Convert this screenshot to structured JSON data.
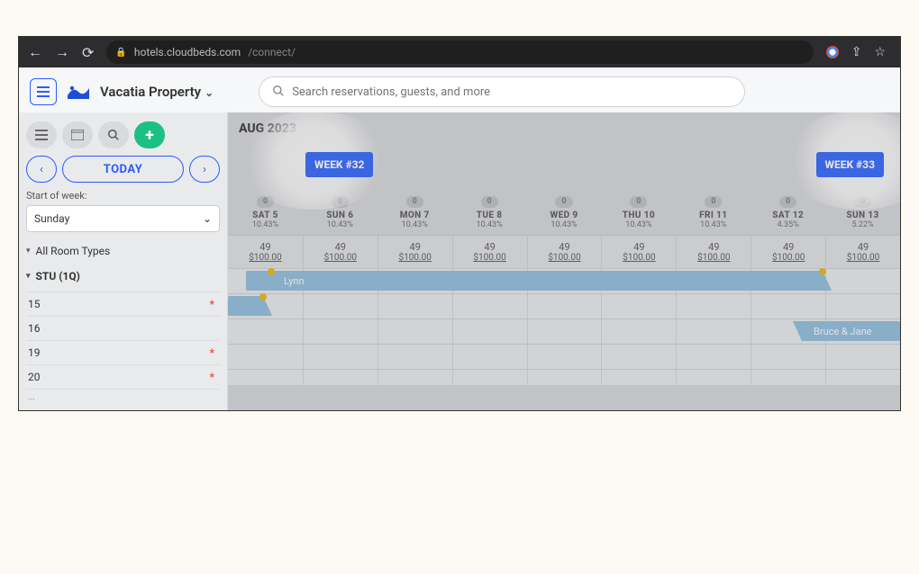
{
  "browser": {
    "url_host": "hotels.cloudbeds.com",
    "url_path": "/connect/"
  },
  "header": {
    "property_name": "Vacatia Property",
    "search_placeholder": "Search reservations, guests, and more"
  },
  "sidebar": {
    "today_label": "TODAY",
    "start_of_week_label": "Start of week:",
    "start_of_week_value": "Sunday",
    "all_room_types": "All Room Types",
    "group_label": "STU (1Q)",
    "rooms": [
      "15",
      "16",
      "19",
      "20"
    ]
  },
  "calendar": {
    "month_label": "AUG 2023",
    "week_chip_1": "WEEK #32",
    "week_chip_2": "WEEK #33",
    "days": [
      {
        "badge": "0",
        "name": "SAT 5",
        "pct": "10.43%",
        "avail": "49",
        "price": "$100.00"
      },
      {
        "badge": "0",
        "name": "SUN 6",
        "pct": "10.43%",
        "avail": "49",
        "price": "$100.00"
      },
      {
        "badge": "0",
        "name": "MON 7",
        "pct": "10.43%",
        "avail": "49",
        "price": "$100.00"
      },
      {
        "badge": "0",
        "name": "TUE 8",
        "pct": "10.43%",
        "avail": "49",
        "price": "$100.00"
      },
      {
        "badge": "0",
        "name": "WED 9",
        "pct": "10.43%",
        "avail": "49",
        "price": "$100.00"
      },
      {
        "badge": "0",
        "name": "THU 10",
        "pct": "10.43%",
        "avail": "49",
        "price": "$100.00"
      },
      {
        "badge": "0",
        "name": "FRI 11",
        "pct": "10.43%",
        "avail": "49",
        "price": "$100.00"
      },
      {
        "badge": "0",
        "name": "SAT 12",
        "pct": "4.35%",
        "avail": "49",
        "price": "$100.00"
      },
      {
        "badge": "0",
        "name": "SUN 13",
        "pct": "5.22%",
        "avail": "49",
        "price": "$100.00"
      }
    ],
    "bookings": {
      "lynn": "Lynn",
      "bruce": "Bruce & Jane"
    }
  }
}
